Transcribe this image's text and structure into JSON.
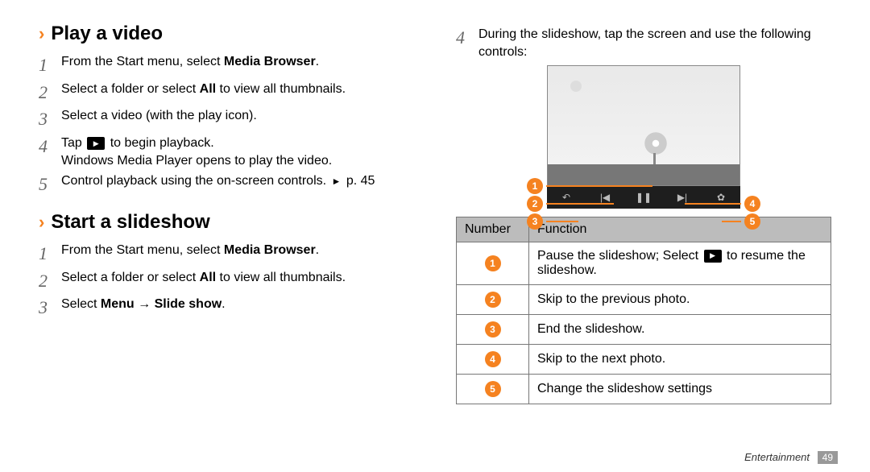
{
  "left": {
    "h1": "Play a video",
    "steps1": [
      {
        "n": "1",
        "pre": "From the Start menu, select ",
        "bold": "Media Browser",
        "post": "."
      },
      {
        "n": "2",
        "pre": "Select a folder or select ",
        "bold": "All",
        "post": " to view all thumbnails."
      },
      {
        "n": "3",
        "pre": "Select a video (with the play icon).",
        "bold": "",
        "post": ""
      },
      {
        "n": "4",
        "pre": "Tap ",
        "icon": true,
        "post": " to begin playback.",
        "line2": "Windows Media Player opens to play the video."
      },
      {
        "n": "5",
        "pre": "Control playback using the on-screen controls. ",
        "ref": "p. 45"
      }
    ],
    "h2": "Start a slideshow",
    "steps2": [
      {
        "n": "1",
        "pre": "From the Start menu, select ",
        "bold": "Media Browser",
        "post": "."
      },
      {
        "n": "2",
        "pre": "Select a folder or select ",
        "bold": "All",
        "post": " to view all thumbnails."
      },
      {
        "n": "3",
        "pre": "Select ",
        "bold": "Menu → Slide show",
        "post": "."
      }
    ]
  },
  "right": {
    "step4": {
      "n": "4",
      "text": "During the slideshow, tap the screen and use the following controls:"
    },
    "ctrlIcons": [
      "↶",
      "|◀",
      "❚❚",
      "▶|",
      "✿"
    ],
    "callouts": [
      "1",
      "2",
      "3",
      "4",
      "5"
    ],
    "table": {
      "head": [
        "Number",
        "Function"
      ],
      "rows": [
        {
          "b": "1",
          "pre": "Pause the slideshow; Select ",
          "icon": true,
          "post": " to resume the slideshow."
        },
        {
          "b": "2",
          "pre": "Skip to the previous photo."
        },
        {
          "b": "3",
          "pre": "End the slideshow."
        },
        {
          "b": "4",
          "pre": "Skip to the next photo."
        },
        {
          "b": "5",
          "pre": "Change the slideshow settings"
        }
      ]
    }
  },
  "footer": {
    "section": "Entertainment",
    "page": "49"
  }
}
